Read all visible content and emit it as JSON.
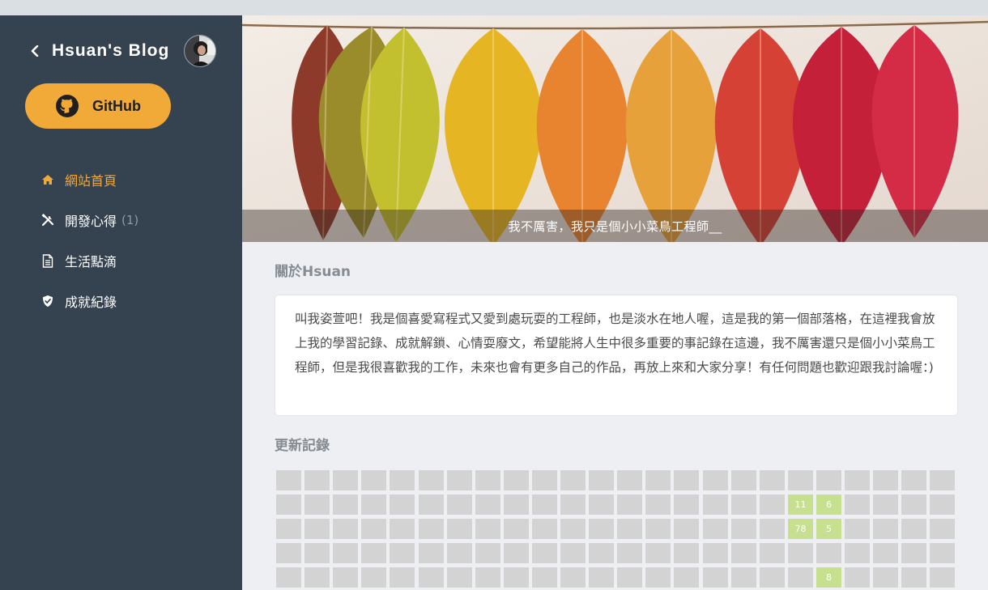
{
  "sidebar": {
    "blog_title": "Hsuan's  Blog",
    "github_label": "GitHub",
    "nav": [
      {
        "icon": "home-icon",
        "label": "網站首頁",
        "active": true
      },
      {
        "icon": "tools-icon",
        "label": "開發心得",
        "count": "(1)"
      },
      {
        "icon": "document-icon",
        "label": "生活點滴"
      },
      {
        "icon": "shield-check-icon",
        "label": "成就紀錄"
      }
    ]
  },
  "hero": {
    "caption": "我不厲害，我只是個小小菜鳥工程師__"
  },
  "about": {
    "title": "關於Hsuan",
    "text": "叫我姿萱吧！我是個喜愛寫程式又愛到處玩耍的工程師，也是淡水在地人喔，這是我的第一個部落格，在這裡我會放上我的學習記錄、成就解鎖、心情耍廢文，希望能將人生中很多重要的事記錄在這邊，我不厲害還只是個小小菜鳥工程師，但是我很喜歡我的工作，未來也會有更多自己的作品，再放上來和大家分享！有任何問題也歡迎跟我討論喔：)"
  },
  "updates": {
    "title": "更新記錄",
    "highlighted": [
      {
        "row": 1,
        "col": 18,
        "value": "11"
      },
      {
        "row": 1,
        "col": 19,
        "value": "6"
      },
      {
        "row": 2,
        "col": 18,
        "value": "78"
      },
      {
        "row": 2,
        "col": 19,
        "value": "5"
      },
      {
        "row": 4,
        "col": 19,
        "value": "8"
      }
    ]
  },
  "colors": {
    "sidebar_bg": "#354250",
    "accent": "#f1a937",
    "highlight_cell": "#c7e08f"
  }
}
